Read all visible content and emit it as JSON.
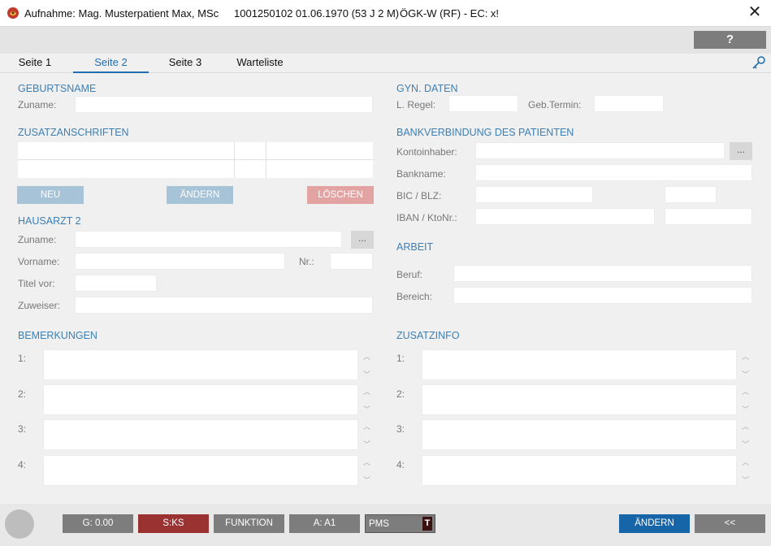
{
  "window": {
    "title": "Aufnahme: Mag. Musterpatient Max, MSc",
    "patient_id": "1001250102 01.06.1970 (53 J 2 M)",
    "insurance": "ÖGK-W (RF) - EC: x!",
    "close_label": "✕"
  },
  "toolbar": {
    "help_label": "?"
  },
  "tabs": [
    {
      "label": "Seite 1"
    },
    {
      "label": "Seite 2"
    },
    {
      "label": "Seite 3"
    },
    {
      "label": "Warteliste"
    }
  ],
  "geburtsname": {
    "header": "GEBURTSNAME",
    "zuname_label": "Zuname:",
    "zuname_value": ""
  },
  "zusatzanschriften": {
    "header": "ZUSATZANSCHRIFTEN",
    "neu": "NEU",
    "aendern": "ÄNDERN",
    "loeschen": "LÖSCHEN"
  },
  "hausarzt": {
    "header": "HAUSARZT 2",
    "zuname_label": "Zuname:",
    "vorname_label": "Vorname:",
    "nr_label": "Nr.:",
    "titel_label": "Titel vor:",
    "zuweiser_label": "Zuweiser:",
    "dots": "..."
  },
  "bemerkungen": {
    "header": "BEMERKUNGEN",
    "rows": [
      "1:",
      "2:",
      "3:",
      "4:"
    ]
  },
  "gyn": {
    "header": "GYN. DATEN",
    "regel_label": "L. Regel:",
    "termin_label": "Geb.Termin:"
  },
  "bank": {
    "header": "BANKVERBINDUNG DES PATIENTEN",
    "inhaber_label": "Kontoinhaber:",
    "bankname_label": "Bankname:",
    "bic_label": "BIC / BLZ:",
    "iban_label": "IBAN / KtoNr.:",
    "dots": "..."
  },
  "arbeit": {
    "header": "ARBEIT",
    "beruf_label": "Beruf:",
    "bereich_label": "Bereich:"
  },
  "zusatzinfo": {
    "header": "ZUSATZINFO",
    "rows": [
      "1:",
      "2:",
      "3:",
      "4:"
    ]
  },
  "statusbar": {
    "g_label": "G: 0.00",
    "sks_label": "S:KS",
    "funktion_label": "FUNKTION",
    "a_label": "A: A1",
    "pms_label": "PMS",
    "pms_badge": "T",
    "aendern_label": "ÄNDERN",
    "back_label": "<<"
  },
  "colors": {
    "accent": "#3b7fb5",
    "neu_button": "#a7c3d8",
    "loeschen_button": "#e4a3a3",
    "sks_button": "#9b3232",
    "aendern_primary": "#1565a8",
    "grey_button": "#7d7d7d"
  }
}
